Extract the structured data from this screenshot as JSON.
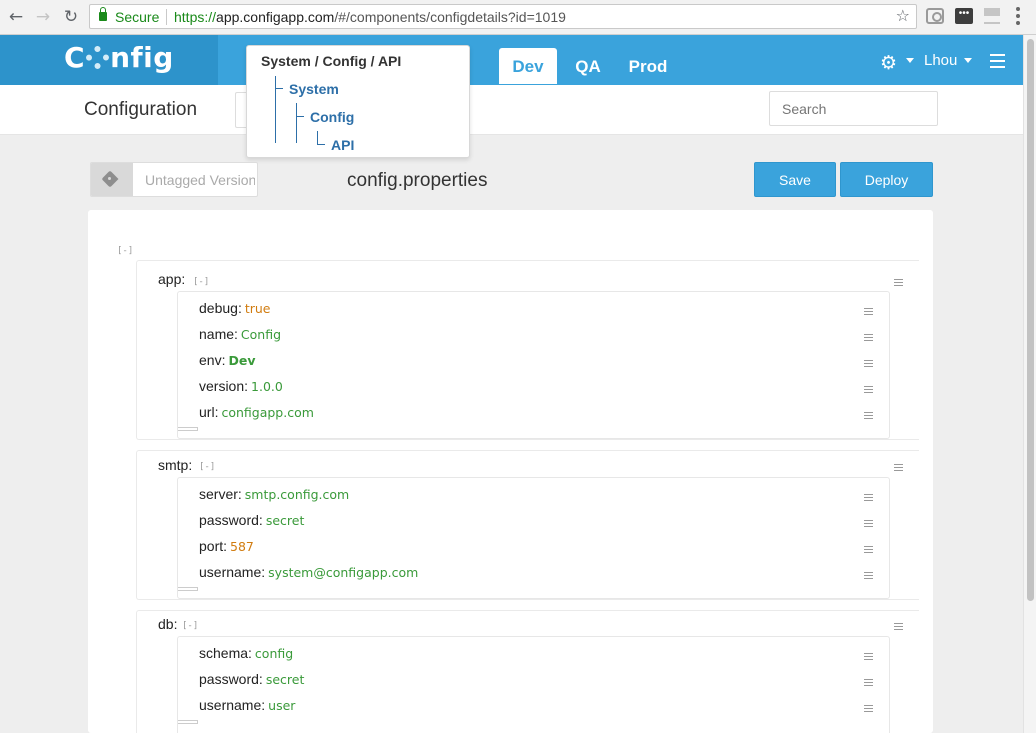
{
  "browser": {
    "secure_label": "Secure",
    "url_scheme": "https://",
    "url_host": "app.configapp.com",
    "url_path": "/#/components/configdetails?id=1019"
  },
  "header": {
    "logo_left": "C",
    "logo_right": "nfig",
    "env_tabs": [
      "Dev",
      "QA",
      "Prod"
    ],
    "active_env": "Dev",
    "user": "Lhou"
  },
  "subheader": {
    "title": "Configuration",
    "search_placeholder": "Search"
  },
  "breadcrumb": {
    "path": "System / Config / API",
    "tree": [
      "System",
      "Config",
      "API"
    ]
  },
  "toolbar": {
    "tag_placeholder": "Untagged Version",
    "filename": "config.properties",
    "save_label": "Save",
    "deploy_label": "Deploy"
  },
  "editor": {
    "collapse_glyph": "[-]",
    "sections": [
      {
        "key": "app",
        "props": [
          {
            "key": "debug",
            "value": "true",
            "type": "bool"
          },
          {
            "key": "name",
            "value": "Config",
            "type": "str"
          },
          {
            "key": "env",
            "value": "Dev",
            "type": "env"
          },
          {
            "key": "version",
            "value": "1.0.0",
            "type": "str"
          },
          {
            "key": "url",
            "value": "configapp.com",
            "type": "str"
          }
        ]
      },
      {
        "key": "smtp",
        "props": [
          {
            "key": "server",
            "value": "smtp.config.com",
            "type": "str"
          },
          {
            "key": "password",
            "value": "secret",
            "type": "str"
          },
          {
            "key": "port",
            "value": "587",
            "type": "num"
          },
          {
            "key": "username",
            "value": "system@configapp.com",
            "type": "str"
          }
        ]
      },
      {
        "key": "db",
        "props": [
          {
            "key": "schema",
            "value": "config",
            "type": "str"
          },
          {
            "key": "password",
            "value": "secret",
            "type": "str"
          },
          {
            "key": "username",
            "value": "user",
            "type": "str"
          }
        ]
      }
    ]
  },
  "colors": {
    "brand": "#3aa3dc",
    "logo_bg": "#2d93cb",
    "string_value": "#3a9a3a",
    "number_value": "#d17c10",
    "tree_link": "#2d6fa8"
  }
}
